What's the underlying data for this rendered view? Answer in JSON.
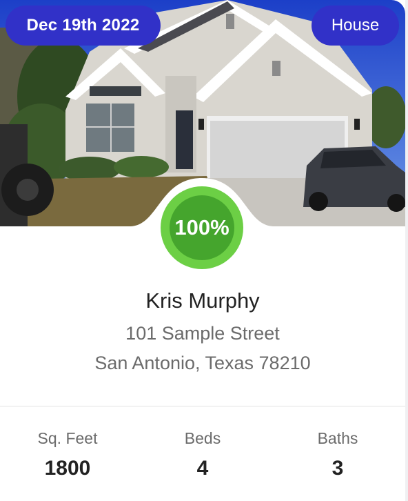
{
  "listing": {
    "date_badge": "Dec 19th 2022",
    "type_badge": "House",
    "score": "100%",
    "owner_name": "Kris Murphy",
    "address_line1": "101 Sample Street",
    "address_line2": "San Antonio, Texas 78210"
  },
  "stats": [
    {
      "label": "Sq. Feet",
      "value": "1800"
    },
    {
      "label": "Beds",
      "value": "4"
    },
    {
      "label": "Baths",
      "value": "3"
    }
  ],
  "colors": {
    "badge": "#3131c8",
    "score_ring": "#6ccf45",
    "score_fill": "#45a52d"
  },
  "icons": {
    "photo": "house-photo"
  }
}
